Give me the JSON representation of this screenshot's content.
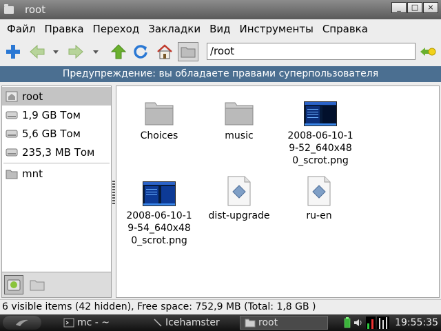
{
  "window": {
    "title": "root",
    "buttons": {
      "minimize": "_",
      "maximize": "□",
      "close": "×"
    }
  },
  "menu": [
    "Файл",
    "Правка",
    "Переход",
    "Закладки",
    "Вид",
    "Инструменты",
    "Справка"
  ],
  "toolbar": {
    "icons": [
      "new-tab-icon",
      "back-icon",
      "forward-icon",
      "up-icon",
      "reload-icon",
      "home-icon",
      "location-toggle-icon",
      "go-icon"
    ],
    "address": "/root"
  },
  "warning": "Предупреждение: вы обладаете правами суперпользователя",
  "sidebar": {
    "items": [
      {
        "label": "root",
        "icon": "home-icon",
        "selected": true
      },
      {
        "label": "1,9 GB Том",
        "icon": "drive-icon"
      },
      {
        "label": "5,6 GB Том",
        "icon": "drive-icon"
      },
      {
        "label": "235,3 MB Том",
        "icon": "drive-icon"
      },
      {
        "label": "mnt",
        "icon": "folder-icon"
      }
    ]
  },
  "files": [
    {
      "name": "Choices",
      "type": "folder"
    },
    {
      "name": "music",
      "type": "folder"
    },
    {
      "name": "2008-06-10-1 9-52_640x48 0_scrot.png",
      "lines": [
        "2008-06-10-1",
        "9-52_640x48",
        "0_scrot.png"
      ],
      "type": "image"
    },
    {
      "name": "2008-06-10-1 9-54_640x48 0_scrot.png",
      "lines": [
        "2008-06-10-1",
        "9-54_640x48",
        "0_scrot.png"
      ],
      "type": "image"
    },
    {
      "name": "dist-upgrade",
      "type": "file"
    },
    {
      "name": "ru-en",
      "type": "file"
    }
  ],
  "status": "6 visible items (42 hidden), Free space: 752,9 MB (Total: 1,8 GB )",
  "taskbar": {
    "tasks": [
      {
        "label": "mc - ~",
        "icon": "terminal-icon"
      },
      {
        "label": "Icehamster",
        "icon": "app-icon"
      },
      {
        "label": "root",
        "icon": "folder-icon",
        "active": true
      }
    ],
    "clock": "19:55:35"
  },
  "colors": {
    "warning_bg": "#4b6f91",
    "titlebar": "#6e6e6e",
    "selection": "#c4c4c4",
    "toolbar_green": "#6ab02e",
    "toolbar_blue": "#2a78d4"
  }
}
